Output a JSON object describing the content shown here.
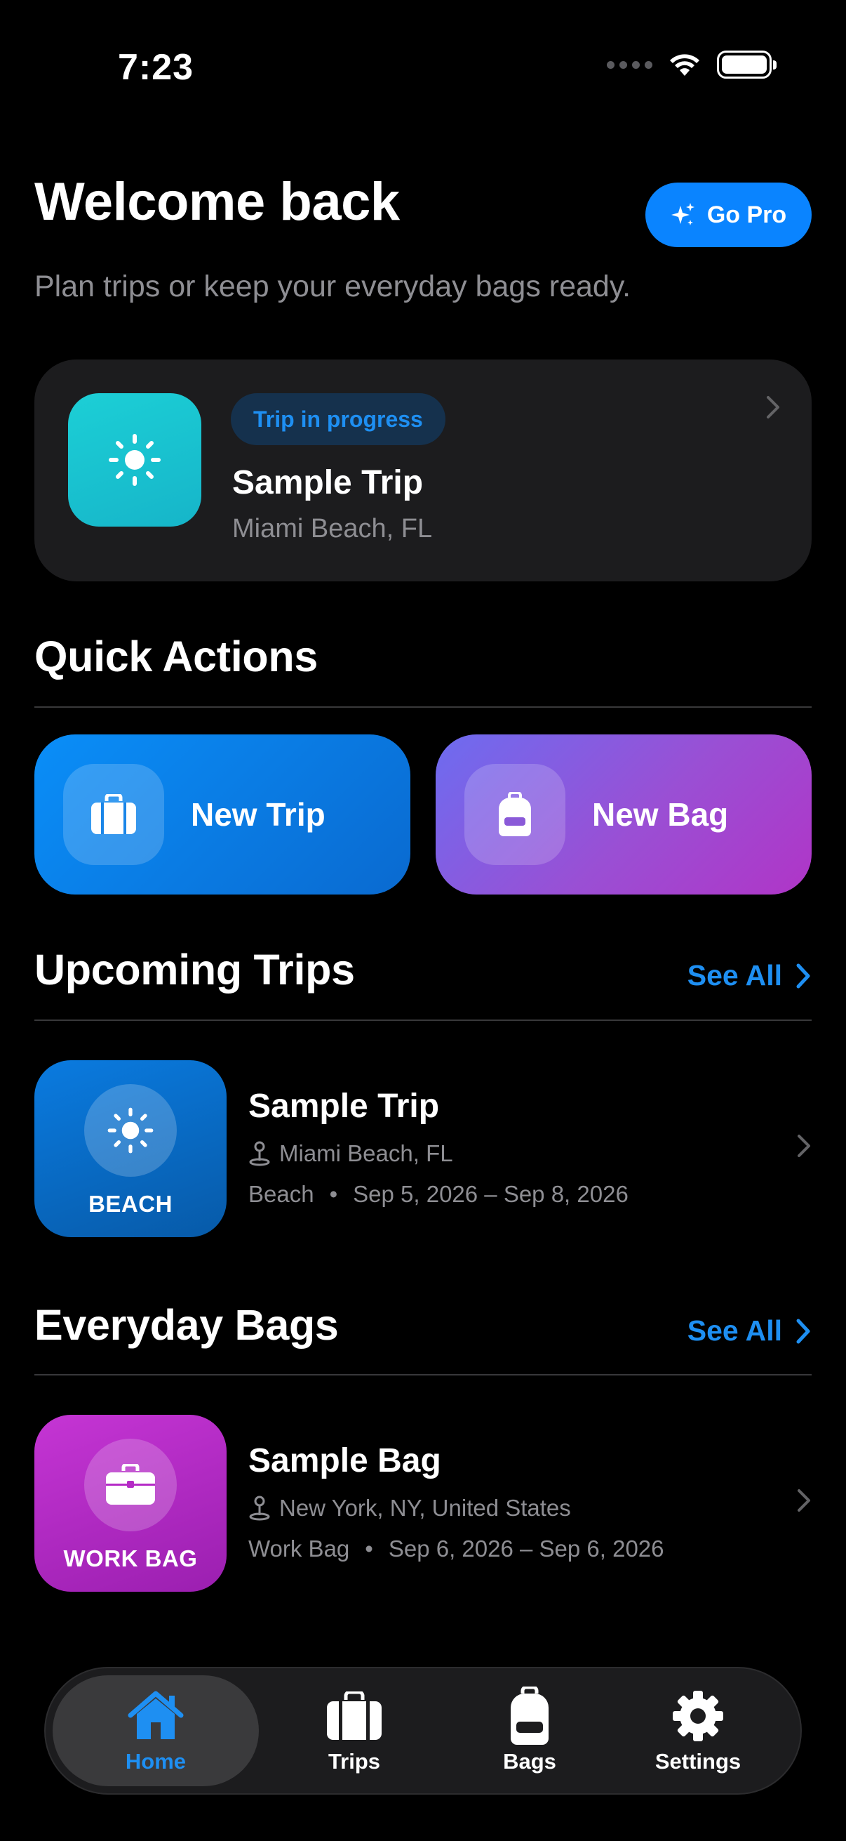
{
  "status_bar": {
    "time": "7:23"
  },
  "header": {
    "title": "Welcome back",
    "go_pro_label": "Go Pro",
    "subtitle": "Plan trips or keep your everyday bags ready."
  },
  "current_trip": {
    "badge": "Trip in progress",
    "name": "Sample Trip",
    "location": "Miami Beach, FL",
    "icon": "sun-icon"
  },
  "quick_actions": {
    "title": "Quick Actions",
    "new_trip_label": "New Trip",
    "new_bag_label": "New Bag"
  },
  "upcoming_trips": {
    "title": "Upcoming Trips",
    "see_all_label": "See All",
    "items": [
      {
        "tile_label": "BEACH",
        "icon": "sun-icon",
        "name": "Sample Trip",
        "location": "Miami Beach, FL",
        "type": "Beach",
        "dates": "Sep 5, 2026 – Sep 8, 2026"
      }
    ]
  },
  "everyday_bags": {
    "title": "Everyday Bags",
    "see_all_label": "See All",
    "items": [
      {
        "tile_label": "WORK BAG",
        "icon": "briefcase-icon",
        "name": "Sample Bag",
        "location": "New York, NY, United States",
        "type": "Work Bag",
        "dates": "Sep 6, 2026 – Sep 6, 2026"
      }
    ]
  },
  "tab_bar": {
    "active": "Home",
    "tabs": [
      {
        "label": "Home",
        "icon": "house-icon"
      },
      {
        "label": "Trips",
        "icon": "suitcase-icon"
      },
      {
        "label": "Bags",
        "icon": "backpack-icon"
      },
      {
        "label": "Settings",
        "icon": "gear-icon"
      }
    ]
  },
  "colors": {
    "accent": "#0a84ff",
    "link": "#1e8ff2",
    "card": "#1c1c1e",
    "secondary_text": "#8e8e93"
  }
}
